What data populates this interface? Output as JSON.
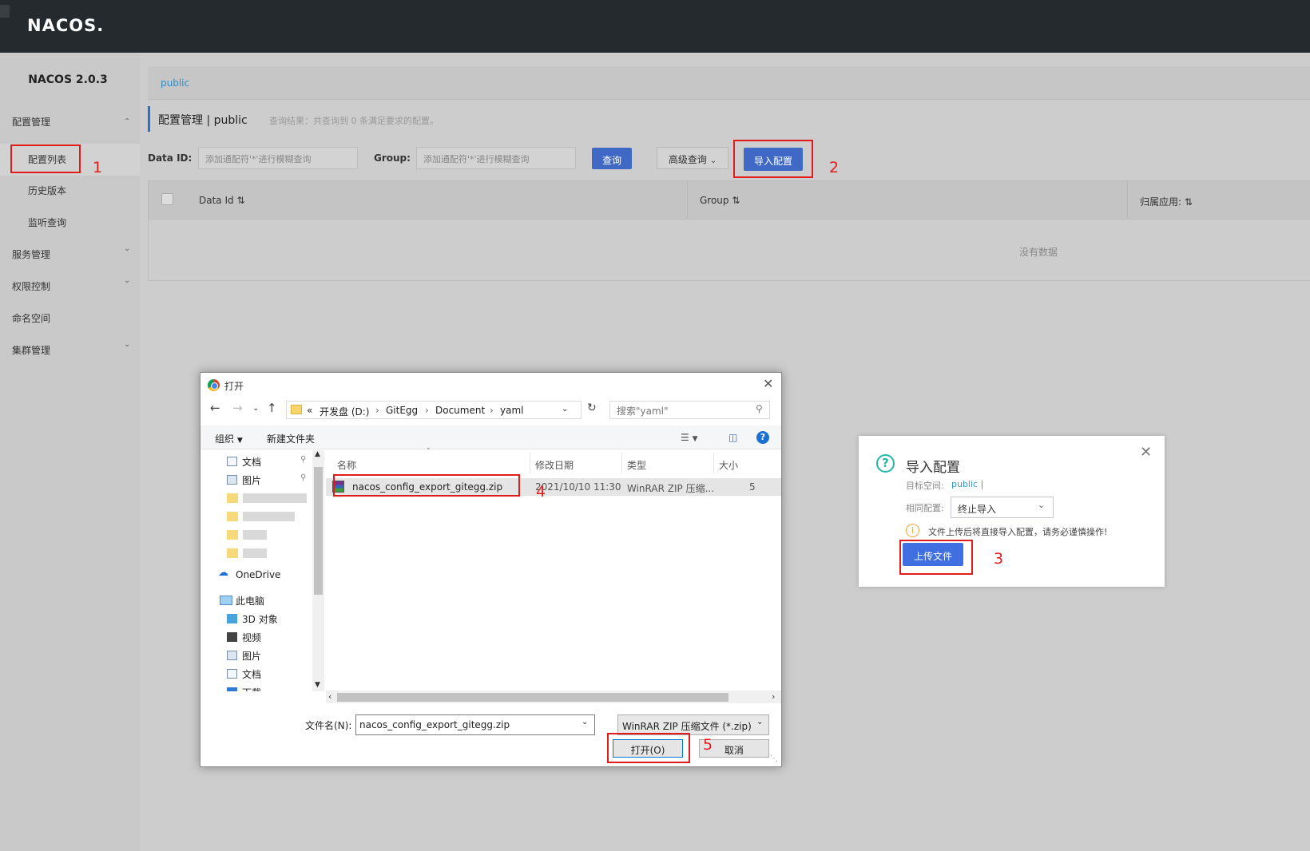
{
  "header": {
    "logo": "NACOS."
  },
  "sidebar": {
    "version": "NACOS 2.0.3",
    "groups": [
      {
        "label": "配置管理",
        "items": [
          "配置列表",
          "历史版本",
          "监听查询"
        ]
      },
      {
        "label": "服务管理"
      },
      {
        "label": "权限控制"
      },
      {
        "label": "命名空间"
      },
      {
        "label": "集群管理"
      }
    ]
  },
  "main": {
    "namespace": "public",
    "page_title": "配置管理  |  public",
    "query_result": "查询结果：共查询到 0 条满足要求的配置。",
    "filters": {
      "data_id_label": "Data ID:",
      "data_id_placeholder": "添加通配符'*'进行模糊查询",
      "group_label": "Group:",
      "group_placeholder": "添加通配符'*'进行模糊查询",
      "query_button": "查询",
      "advanced_button": "高级查询",
      "import_button": "导入配置"
    },
    "table": {
      "columns": [
        "Data Id",
        "Group",
        "归属应用:"
      ],
      "empty_text": "没有数据"
    }
  },
  "annotations": [
    "1",
    "2",
    "3",
    "4",
    "5"
  ],
  "file_dialog": {
    "title": "打开",
    "path": [
      "«",
      "开发盘 (D:)",
      "GitEgg",
      "Document",
      "yaml"
    ],
    "search_placeholder": "搜索\"yaml\"",
    "toolbar": {
      "organize": "组织",
      "new_folder": "新建文件夹"
    },
    "tree": [
      "文档",
      "图片",
      "OneDrive",
      "此电脑",
      "3D 对象",
      "视频",
      "图片",
      "文档",
      "下载"
    ],
    "columns": [
      "名称",
      "修改日期",
      "类型",
      "大小"
    ],
    "files": [
      {
        "name": "nacos_config_export_gitegg.zip",
        "modified": "2021/10/10 11:30",
        "type": "WinRAR ZIP 压缩...",
        "size": "5"
      }
    ],
    "filename_label": "文件名(N):",
    "filename_value": "nacos_config_export_gitegg.zip",
    "filter": "WinRAR ZIP 压缩文件 (*.zip)",
    "open_button": "打开(O)",
    "cancel_button": "取消"
  },
  "import_popup": {
    "title": "导入配置",
    "target_ns_label": "目标空间:",
    "target_ns_value": "public |",
    "same_config_label": "相同配置:",
    "same_config_value": "终止导入",
    "warning": "文件上传后将直接导入配置，请务必谨慎操作!",
    "upload_button": "上传文件"
  },
  "colors": {
    "topbar": "#252a2f",
    "primary": "#3f69c5",
    "annotation_red": "#e21b1b",
    "teal": "#23b7a5"
  }
}
